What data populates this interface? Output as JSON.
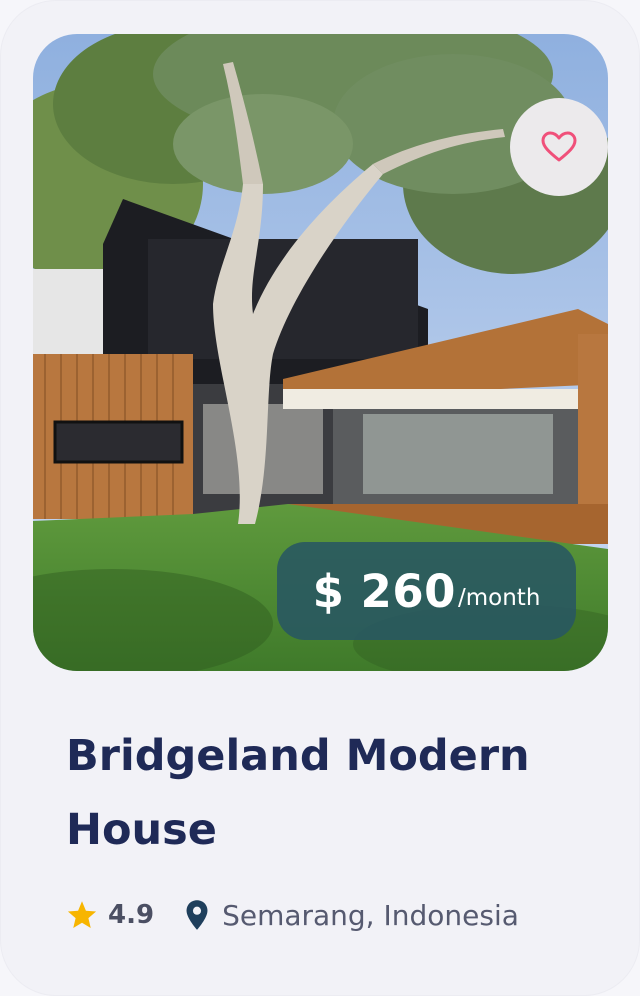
{
  "listing": {
    "price_amount": "$ 260",
    "price_period": "/month",
    "title": "Bridgeland Modern House",
    "rating": "4.9",
    "location": "Semarang, Indonesia"
  },
  "icons": {
    "favorite": "heart-outline-icon",
    "rating": "star-icon",
    "location": "map-pin-icon"
  },
  "colors": {
    "title": "#1f2a57",
    "price_badge": "#285662",
    "heart": "#f0507a",
    "star": "#f7b500",
    "pin": "#1f3f5c"
  }
}
